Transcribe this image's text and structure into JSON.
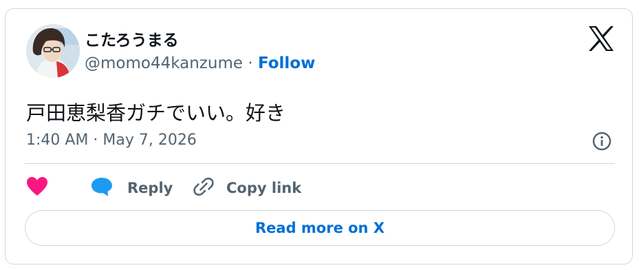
{
  "author": {
    "display_name": "こたろうまる",
    "handle": "@momo44kanzume",
    "separator": "·",
    "follow_label": "Follow"
  },
  "tweet": {
    "text": "戸田恵梨香ガチでいい。好き",
    "timestamp": "1:40 AM · May 7, 2026"
  },
  "actions": {
    "reply_label": "Reply",
    "copy_link_label": "Copy link"
  },
  "read_more_label": "Read more on X",
  "colors": {
    "like": "#f91880",
    "reply": "#1d9bf0",
    "link": "#006fd6",
    "secondary_text": "#536471",
    "border": "#cfd9de"
  },
  "icons": [
    "x-logo-icon",
    "info-icon",
    "heart-icon",
    "reply-bubble-icon",
    "link-icon"
  ]
}
